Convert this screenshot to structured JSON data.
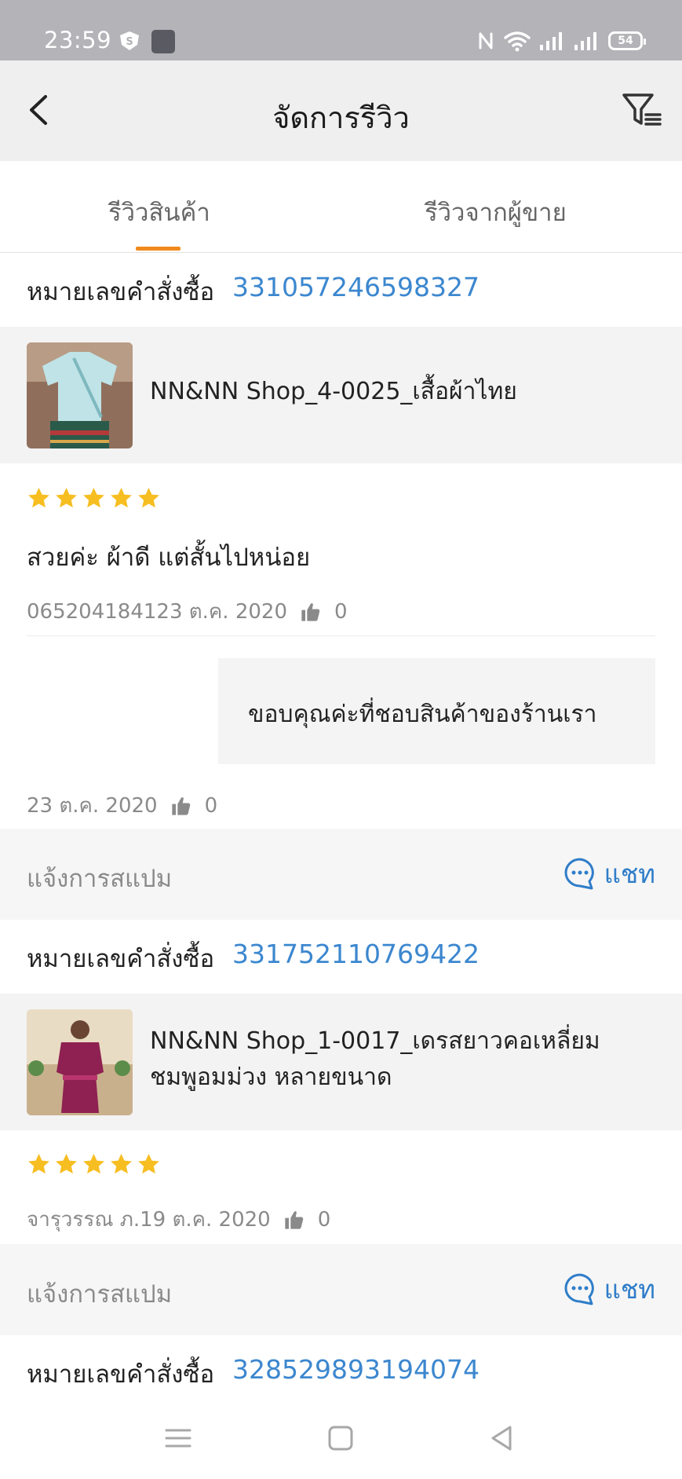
{
  "status": {
    "time": "23:59",
    "battery": "54"
  },
  "header": {
    "title": "จัดการรีวิว"
  },
  "tabs": [
    {
      "label": "รีวิวสินค้า",
      "active": true
    },
    {
      "label": "รีวิวจากผู้ขาย",
      "active": false
    }
  ],
  "reviews": [
    {
      "order_label": "หมายเลขคำสั่งซื้อ",
      "order_number": "331057246598327",
      "product_name": "NN&NN Shop_4-0025_เสื้อผ้าไทย",
      "rating": 5,
      "comment": "สวยค่ะ ผ้าดี แต่สั้นไปหน่อย",
      "reviewer_date": "065204184123 ต.ค. 2020",
      "likes": "0",
      "seller_reply": "ขอบคุณค่ะที่ชอบสินค้าของร้านเรา",
      "reply_date": "23 ต.ค. 2020",
      "reply_likes": "0",
      "spam_label": "แจ้งการสแปม",
      "chat_label": "แชท"
    },
    {
      "order_label": "หมายเลขคำสั่งซื้อ",
      "order_number": "331752110769422",
      "product_name_line1": "NN&NN Shop_1-0017_เดรสยาวคอเหลี่ยม",
      "product_name_line2": "ชมพูอมม่วง หลายขนาด",
      "rating": 5,
      "reviewer_date": "จารุวรรณ ภ.19 ต.ค. 2020",
      "likes": "0",
      "spam_label": "แจ้งการสแปม",
      "chat_label": "แชท"
    },
    {
      "order_label": "หมายเลขคำสั่งซื้อ",
      "order_number": "328529893194074"
    }
  ],
  "colors": {
    "accent_tab": "#f08a1c",
    "order_link": "#3c87cf",
    "star": "#f7be22",
    "chat": "#2f7dc9"
  },
  "icons": [
    "back-arrow-icon",
    "filter-icon",
    "star-icon",
    "thumbs-up-icon",
    "chat-bubble-icon",
    "menu-icon",
    "home-square-icon",
    "back-triangle-icon"
  ]
}
